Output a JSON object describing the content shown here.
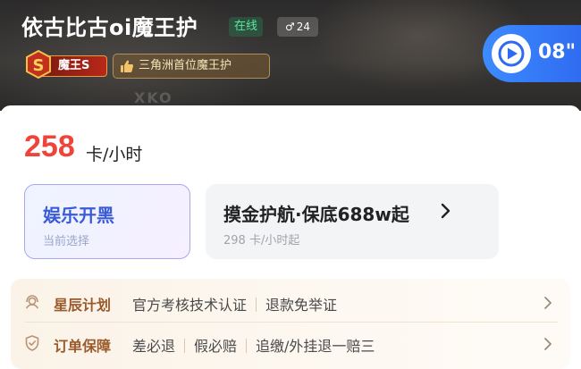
{
  "profile": {
    "name": "依古比古oi魔王护",
    "status": "在线",
    "gender_symbol": "♂",
    "age": "24",
    "rank_badge": "魔王S",
    "title_badge": "三角洲首位魔王护"
  },
  "voice": {
    "duration": "08\""
  },
  "pricing": {
    "price": "258",
    "unit": "卡/小时"
  },
  "options": [
    {
      "title": "娱乐开黑",
      "subtitle": "当前选择",
      "selected": true
    },
    {
      "title": "摸金护航·保底688w起",
      "subtitle": "298 卡/小时起",
      "selected": false
    }
  ],
  "guarantees": [
    {
      "name": "星辰计划",
      "icon": "service-agent-icon",
      "items": [
        "官方考核技术认证",
        "退款免举证"
      ]
    },
    {
      "name": "订单保障",
      "icon": "shield-check-icon",
      "items": [
        "差必退",
        "假必赔",
        "追缴/外挂退一赔三"
      ]
    }
  ],
  "colors": {
    "price_red": "#f0443a",
    "selected_blue": "#3a5bd9",
    "voice_blue": "#3d8bff",
    "online_green": "#5ee6a0",
    "guarantee_brown": "#9a5a2a"
  }
}
